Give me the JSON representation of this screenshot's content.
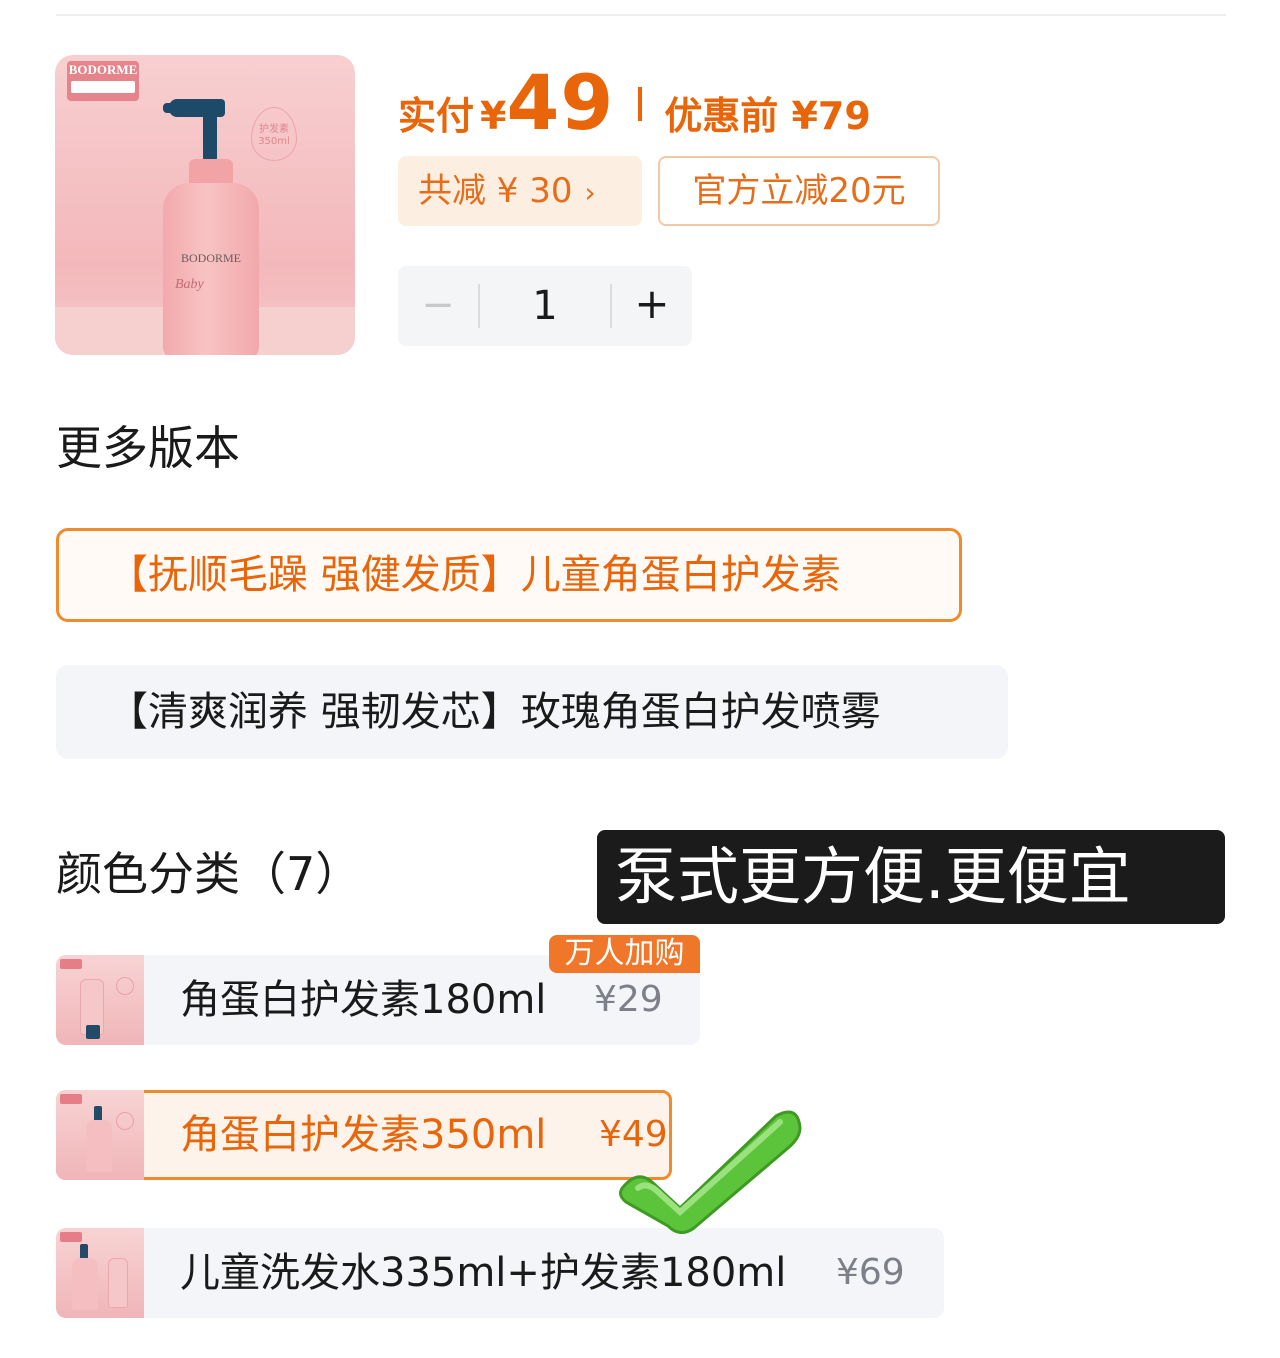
{
  "product": {
    "brand": "BODORME",
    "badge_text": "护发素 350ml",
    "label_baby": "Baby"
  },
  "price": {
    "pay_label": "实付",
    "currency": "¥",
    "pay_amount": "49",
    "before_label": "优惠前 ¥79"
  },
  "discount": {
    "total_label": "共减 ¥ 30",
    "chevron": "›",
    "coupon_label": "官方立减20元"
  },
  "quantity": {
    "minus": "−",
    "value": "1",
    "plus": "+"
  },
  "versions": {
    "title": "更多版本",
    "options": [
      {
        "label": "【抚顺毛躁 强健发质】儿童角蛋白护发素",
        "selected": true
      },
      {
        "label": "【清爽润养 强韧发芯】玫瑰角蛋白护发喷雾",
        "selected": false
      }
    ]
  },
  "colors": {
    "title": "颜色分类（7）",
    "hot_badge": "万人加购",
    "options": [
      {
        "name": "角蛋白护发素180ml",
        "price": "¥29",
        "selected": false
      },
      {
        "name": "角蛋白护发素350ml",
        "price": "¥49",
        "selected": true
      },
      {
        "name": "儿童洗发水335ml+护发素180ml",
        "price": "¥69",
        "selected": false
      }
    ]
  },
  "overlay": {
    "text": "泵式更方便.更便宜"
  },
  "icons": {
    "checkmark": "green-check-icon"
  },
  "colors_palette": {
    "accent": "#e8650a",
    "border_accent": "#ef8b2c",
    "check_green": "#5cc43a"
  }
}
